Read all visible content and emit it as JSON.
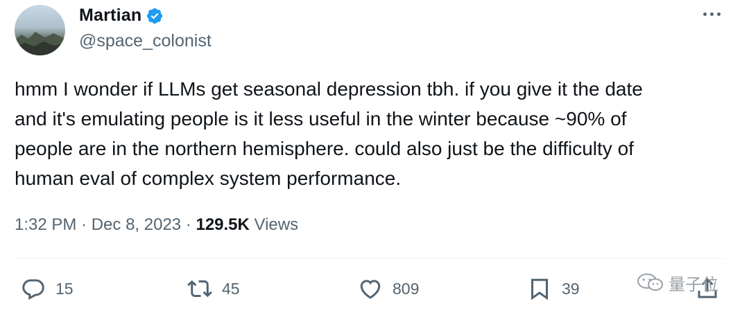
{
  "author": {
    "display_name": "Martian",
    "handle": "@space_colonist",
    "verified": true
  },
  "tweet": {
    "text": "hmm I wonder if LLMs get seasonal depression tbh. if you give it the date\nand it's emulating people is it less useful in the winter because ~90% of\npeople are in the northern hemisphere. could also just be the difficulty of\nhuman eval of complex system performance.",
    "time": "1:32 PM",
    "separator": " · ",
    "date": "Dec 8, 2023",
    "views_count": "129.5K",
    "views_label": " Views"
  },
  "actions": {
    "replies": "15",
    "retweets": "45",
    "likes": "809",
    "bookmarks": "39"
  },
  "watermark": {
    "text": "量子位"
  },
  "colors": {
    "text": "#0f1419",
    "secondary": "#536471",
    "verified": "#1d9bf0",
    "divider": "#eff3f4"
  },
  "icons": [
    "more-icon",
    "verified-icon",
    "reply-icon",
    "retweet-icon",
    "like-icon",
    "bookmark-icon",
    "share-icon",
    "wechat-icon"
  ]
}
